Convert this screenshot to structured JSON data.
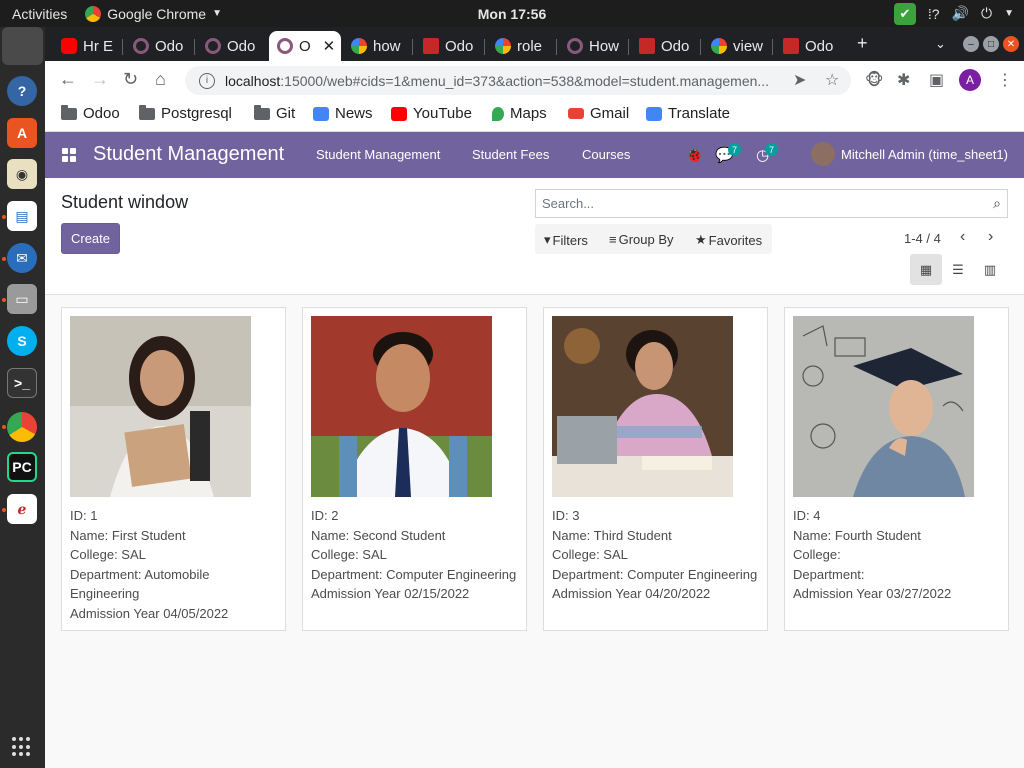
{
  "desktop": {
    "activities": "Activities",
    "app_name": "Google Chrome",
    "clock": "Mon 17:56"
  },
  "browser": {
    "tabs": [
      {
        "title": "Hr E",
        "icon": "youtube-icon"
      },
      {
        "title": "Odo",
        "icon": "odoo-icon"
      },
      {
        "title": "Odo",
        "icon": "odoo-icon"
      },
      {
        "title": "O",
        "icon": "odoo-icon",
        "active": true
      },
      {
        "title": "how",
        "icon": "google-icon"
      },
      {
        "title": "Odo",
        "icon": "ext-icon"
      },
      {
        "title": "role",
        "icon": "google-icon"
      },
      {
        "title": "How",
        "icon": "odoo-icon"
      },
      {
        "title": "Odo",
        "icon": "ext-icon"
      },
      {
        "title": "view",
        "icon": "google-icon"
      },
      {
        "title": "Odo",
        "icon": "ext-icon"
      }
    ],
    "url_host": "localhost",
    "url_rest": ":15000/web#cids=1&menu_id=373&action=538&model=student.managemen...",
    "profile_initial": "A",
    "bookmarks": [
      {
        "label": "Odoo",
        "icon": "folder-icon"
      },
      {
        "label": "Postgresql",
        "icon": "folder-icon"
      },
      {
        "label": "Git",
        "icon": "folder-icon"
      },
      {
        "label": "News",
        "icon": "news-icon"
      },
      {
        "label": "YouTube",
        "icon": "youtube-icon"
      },
      {
        "label": "Maps",
        "icon": "maps-icon"
      },
      {
        "label": "Gmail",
        "icon": "gmail-icon"
      },
      {
        "label": "Translate",
        "icon": "translate-icon"
      }
    ]
  },
  "odoo": {
    "app_title": "Student Management",
    "menu": [
      "Student Management",
      "Student Fees",
      "Courses"
    ],
    "messages_count": "7",
    "activities_count": "7",
    "user": "Mitchell Admin (time_sheet1)",
    "breadcrumb": "Student window",
    "create_label": "Create",
    "search_placeholder": "Search...",
    "filters_label": "Filters",
    "groupby_label": "Group By",
    "favorites_label": "Favorites",
    "pager": "1-4 / 4",
    "view_modes": [
      "kanban-view-icon",
      "list-view-icon",
      "graph-view-icon"
    ],
    "students": [
      {
        "id": "ID: 1",
        "name": "Name: First Student",
        "college": "College: SAL",
        "department": "Department: Automobile Engineering",
        "admission": "Admission Year 04/05/2022"
      },
      {
        "id": "ID: 2",
        "name": "Name: Second Student",
        "college": "College: SAL",
        "department": "Department: Computer Engineering",
        "admission": "Admission Year 02/15/2022"
      },
      {
        "id": "ID: 3",
        "name": "Name: Third Student",
        "college": "College: SAL",
        "department": "Department: Computer Engineering",
        "admission": "Admission Year 04/20/2022"
      },
      {
        "id": "ID: 4",
        "name": "Name: Fourth Student",
        "college": "College:",
        "department": "Department:",
        "admission": "Admission Year 03/27/2022"
      }
    ],
    "colors": {
      "navbar": "#71639e",
      "primary": "#71639e"
    }
  }
}
